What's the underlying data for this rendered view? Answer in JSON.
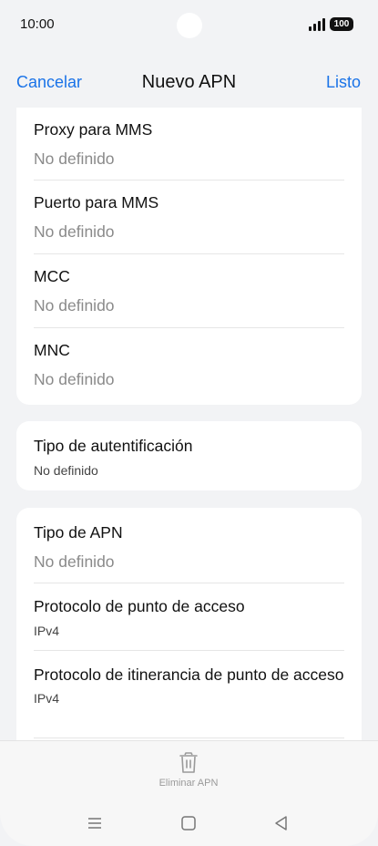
{
  "status": {
    "time": "10:00",
    "battery": "100"
  },
  "nav": {
    "cancel": "Cancelar",
    "title": "Nuevo APN",
    "done": "Listo"
  },
  "card1": {
    "rows": [
      {
        "label": "Proxy para MMS",
        "value": "No definido"
      },
      {
        "label": "Puerto para MMS",
        "value": "No definido"
      },
      {
        "label": "MCC",
        "value": "No definido"
      },
      {
        "label": "MNC",
        "value": "No definido"
      }
    ]
  },
  "card2": {
    "rows": [
      {
        "label": "Tipo de autentificación",
        "value": "No definido"
      }
    ]
  },
  "card3": {
    "rows": [
      {
        "label": "Tipo de APN",
        "value": "No definido"
      },
      {
        "label": "Protocolo de punto de acceso",
        "value": "IPv4"
      },
      {
        "label": "Protocolo de itinerancia de punto de acceso",
        "value": "IPv4"
      }
    ]
  },
  "bottom": {
    "delete_label": "Eliminar APN"
  }
}
